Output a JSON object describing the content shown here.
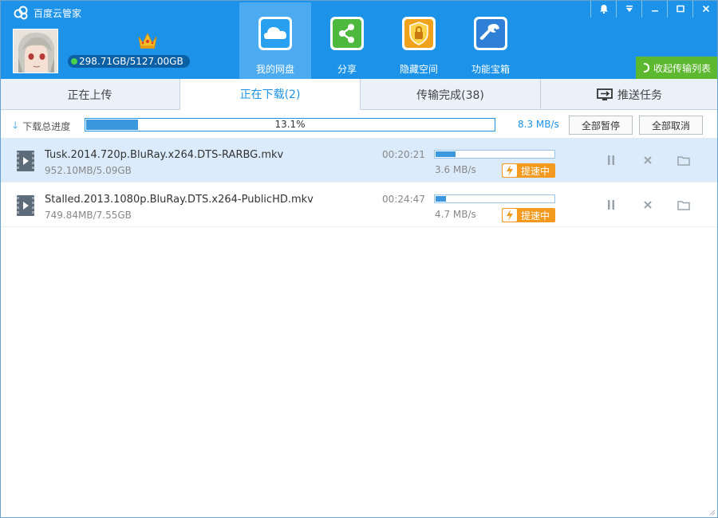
{
  "app": {
    "title": "百度云管家"
  },
  "user": {
    "quota": "298.71GB/5127.00GB"
  },
  "nav": [
    {
      "label": "我的网盘",
      "icon": "cloud-icon",
      "color": "#1c93e8"
    },
    {
      "label": "分享",
      "icon": "share-icon",
      "color": "#4cb83d"
    },
    {
      "label": "隐藏空间",
      "icon": "lock-icon",
      "color": "#f0a21a"
    },
    {
      "label": "功能宝箱",
      "icon": "wrench-icon",
      "color": "#2f7fd7"
    }
  ],
  "collapse_label": "收起传输列表",
  "tabs": {
    "upload": "正在上传",
    "download": "正在下载(2)",
    "done": "传输完成(38)",
    "push": "推送任务"
  },
  "total": {
    "label": "下载总进度",
    "progress": 0.131,
    "percent": "13.1%",
    "speed": "8.3 MB/s",
    "pause_all": "全部暂停",
    "cancel_all": "全部取消"
  },
  "downloads": [
    {
      "name": "Tusk.2014.720p.BluRay.x264.DTS-RARBG.mkv",
      "size": "952.10MB/5.09GB",
      "time": "00:20:21",
      "progress": 0.18,
      "speed": "3.6 MB/s",
      "boost": "提速中"
    },
    {
      "name": "Stalled.2013.1080p.BluRay.DTS.x264-PublicHD.mkv",
      "size": "749.84MB/7.55GB",
      "time": "00:24:47",
      "progress": 0.097,
      "speed": "4.7 MB/s",
      "boost": "提速中"
    }
  ],
  "colors": {
    "brand": "#1c93e8",
    "boost": "#f39a1f",
    "collapse": "#5cb82e"
  }
}
